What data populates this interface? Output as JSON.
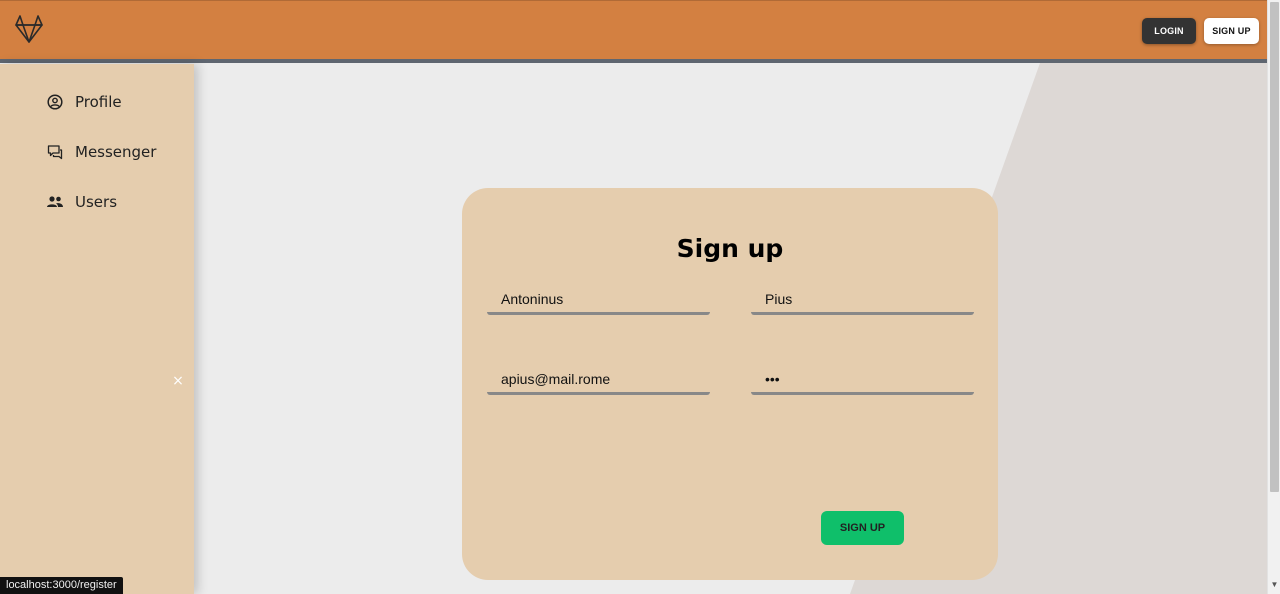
{
  "header": {
    "login_label": "LOGIN",
    "signup_label": "SIGN UP"
  },
  "sidebar": {
    "items": [
      {
        "label": "Profile",
        "icon": "profile-icon"
      },
      {
        "label": "Messenger",
        "icon": "messenger-icon"
      },
      {
        "label": "Users",
        "icon": "users-icon"
      }
    ],
    "close_glyph": "×"
  },
  "form": {
    "title": "Sign up",
    "first_name": "Antoninus",
    "last_name": "Pius",
    "email": "apius@mail.rome",
    "password": "•••",
    "submit_label": "SIGN UP"
  },
  "status_bar": {
    "url": "localhost:3000/register"
  },
  "colors": {
    "header": "#d38041",
    "sidebar": "#e5cdae",
    "card": "#e5cdae",
    "submit": "#0fbf6a",
    "login_button": "#333333"
  }
}
